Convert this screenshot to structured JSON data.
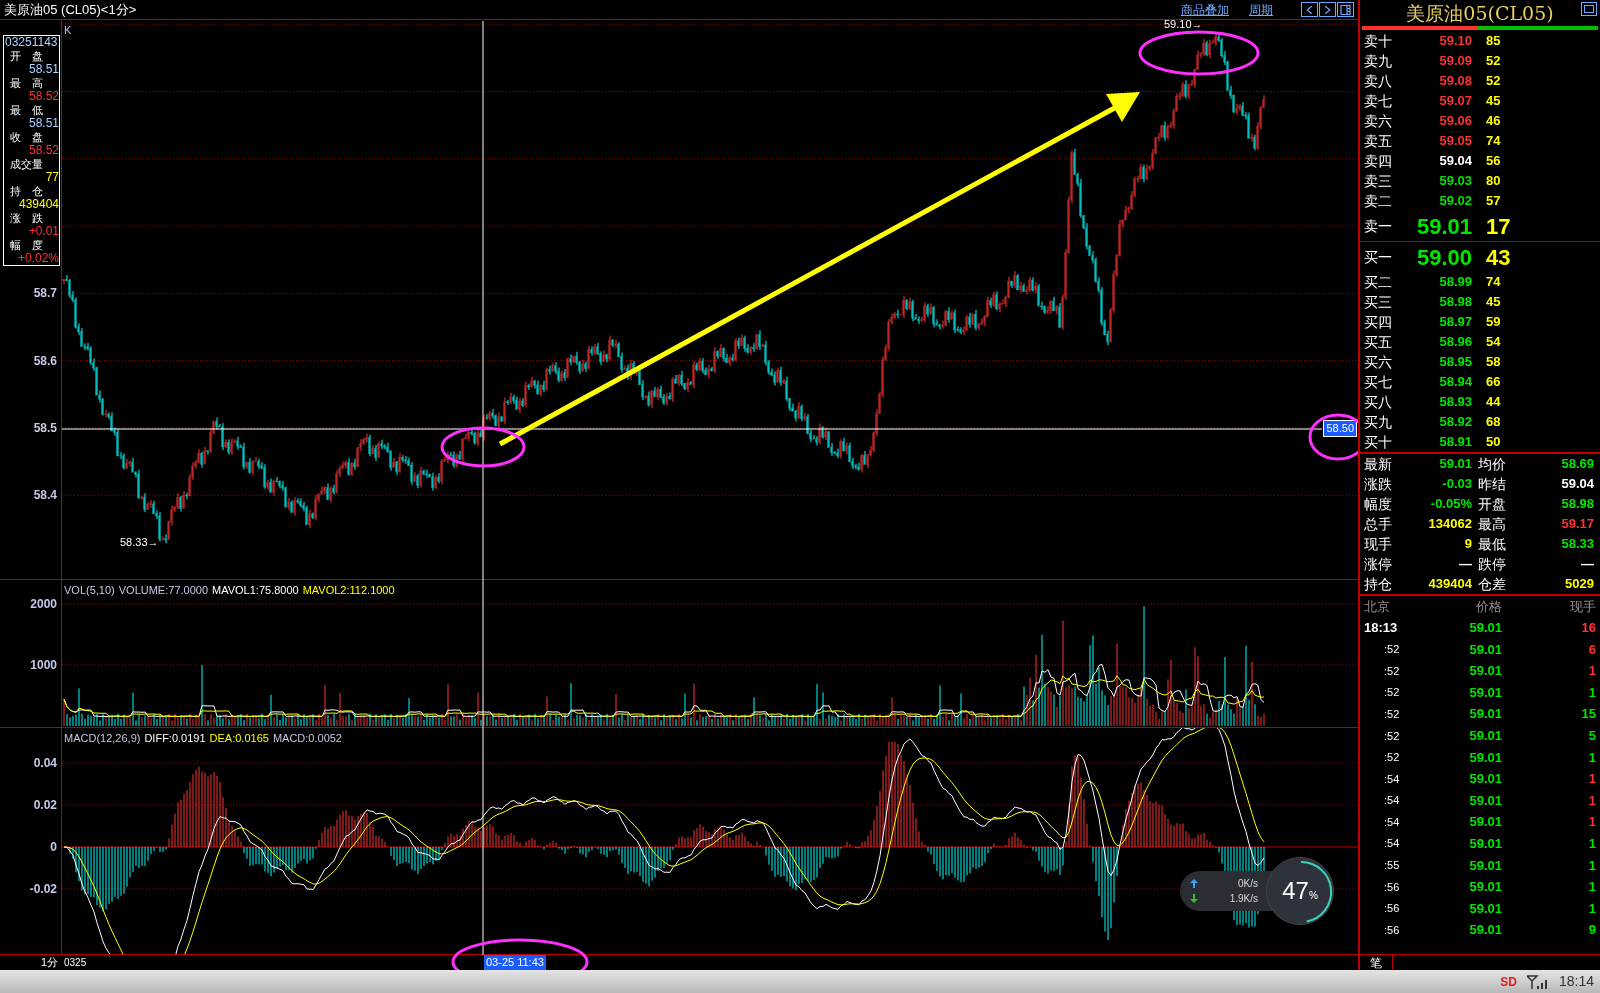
{
  "title_bar": {
    "title": "美原油05 (CL05)<1分>",
    "links": [
      "商品叠加",
      "周期"
    ]
  },
  "info_panel": {
    "time": "03251143",
    "fields": [
      {
        "label": "开　盘",
        "value": "58.51",
        "color": "#a8d4ff"
      },
      {
        "label": "最　高",
        "value": "58.52",
        "color": "#ff3232"
      },
      {
        "label": "最　低",
        "value": "58.51",
        "color": "#a8d4ff"
      },
      {
        "label": "收　盘",
        "value": "58.52",
        "color": "#ff3232"
      },
      {
        "label": "成交量",
        "value": "77",
        "color": "#ffff00"
      },
      {
        "label": "持　仓",
        "value": "439404",
        "color": "#ffff00"
      },
      {
        "label": "涨　跌",
        "value": "+0.01",
        "color": "#ff3232"
      },
      {
        "label": "幅　度",
        "value": "+0.02%",
        "color": "#ff3232"
      }
    ]
  },
  "price_chart": {
    "corner_label": "K",
    "axis_labels": [
      "58.7",
      "58.6",
      "58.5",
      "58.4"
    ],
    "high_marker": "59.10→",
    "low_marker": "58.33→",
    "crosshair_price": "58.50",
    "crosshair_time": "03-25 11:43"
  },
  "volume_chart": {
    "legend": [
      {
        "text": "VOL(5,10)",
        "color": "#c8c8e8"
      },
      {
        "text": "VOLUME:77.0000",
        "color": "#c8c8e8"
      },
      {
        "text": "MAVOL1:75.8000",
        "color": "#ffffff"
      },
      {
        "text": "MAVOL2:112.1000",
        "color": "#ffff00"
      }
    ],
    "axis_labels": [
      "2000",
      "1000"
    ]
  },
  "macd_chart": {
    "legend": [
      {
        "text": "MACD(12,26,9)",
        "color": "#c8c8e8"
      },
      {
        "text": "DIFF:0.0191",
        "color": "#ffffff"
      },
      {
        "text": "DEA:0.0165",
        "color": "#ffff00"
      },
      {
        "text": "MACD:0.0052",
        "color": "#c8c8e8"
      }
    ],
    "axis_labels": [
      "0.04",
      "0.02",
      "0",
      "-0.02"
    ]
  },
  "time_axis": {
    "period": "1分",
    "date": "0325"
  },
  "quote_panel": {
    "title": "美原油05(CL05)",
    "ratio_bar": {
      "level": 0.49
    },
    "asks": [
      {
        "label": "卖十",
        "price": "59.10",
        "volume": "85",
        "color": "#ff3232",
        "kind": "level"
      },
      {
        "label": "卖九",
        "price": "59.09",
        "volume": "52",
        "color": "#ff3232",
        "kind": "level"
      },
      {
        "label": "卖八",
        "price": "59.08",
        "volume": "52",
        "color": "#ff3232",
        "kind": "level"
      },
      {
        "label": "卖七",
        "price": "59.07",
        "volume": "45",
        "color": "#ff3232",
        "kind": "level"
      },
      {
        "label": "卖六",
        "price": "59.06",
        "volume": "46",
        "color": "#ff3232",
        "kind": "level"
      },
      {
        "label": "卖五",
        "price": "59.05",
        "volume": "74",
        "color": "#ff3232",
        "kind": "level"
      },
      {
        "label": "卖四",
        "price": "59.04",
        "volume": "56",
        "color": "#ffffff",
        "kind": "level"
      },
      {
        "label": "卖三",
        "price": "59.03",
        "volume": "80",
        "color": "#00e600",
        "kind": "level"
      },
      {
        "label": "卖二",
        "price": "59.02",
        "volume": "57",
        "color": "#00e600",
        "kind": "level"
      },
      {
        "label": "卖一",
        "price": "59.01",
        "volume": "17",
        "color": "#00e600",
        "kind": "best"
      }
    ],
    "bids": [
      {
        "label": "买一",
        "price": "59.00",
        "volume": "43",
        "color": "#00e600",
        "kind": "best"
      },
      {
        "label": "买二",
        "price": "58.99",
        "volume": "74",
        "color": "#00e600",
        "kind": "level"
      },
      {
        "label": "买三",
        "price": "58.98",
        "volume": "45",
        "color": "#00e600",
        "kind": "level"
      },
      {
        "label": "买四",
        "price": "58.97",
        "volume": "59",
        "color": "#00e600",
        "kind": "level"
      },
      {
        "label": "买五",
        "price": "58.96",
        "volume": "54",
        "color": "#00e600",
        "kind": "level"
      },
      {
        "label": "买六",
        "price": "58.95",
        "volume": "58",
        "color": "#00e600",
        "kind": "level"
      },
      {
        "label": "买七",
        "price": "58.94",
        "volume": "66",
        "color": "#00e600",
        "kind": "level"
      },
      {
        "label": "买八",
        "price": "58.93",
        "volume": "44",
        "color": "#00e600",
        "kind": "level"
      },
      {
        "label": "买九",
        "price": "58.92",
        "volume": "68",
        "color": "#00e600",
        "kind": "level"
      },
      {
        "label": "买十",
        "price": "58.91",
        "volume": "50",
        "color": "#00e600",
        "kind": "level"
      }
    ],
    "stats": [
      [
        {
          "label": "最新",
          "value": "59.01",
          "color": "#00e600"
        },
        {
          "label": "均价",
          "value": "58.69",
          "color": "#00e600"
        }
      ],
      [
        {
          "label": "涨跌",
          "value": "-0.03",
          "color": "#00e600"
        },
        {
          "label": "昨结",
          "value": "59.04",
          "color": "#ffffff"
        }
      ],
      [
        {
          "label": "幅度",
          "value": "-0.05%",
          "color": "#00e600"
        },
        {
          "label": "开盘",
          "value": "58.98",
          "color": "#00e600"
        }
      ],
      [
        {
          "label": "总手",
          "value": "134062",
          "color": "#ffff00"
        },
        {
          "label": "最高",
          "value": "59.17",
          "color": "#ff3232"
        }
      ],
      [
        {
          "label": "现手",
          "value": "9",
          "color": "#ffff00"
        },
        {
          "label": "最低",
          "value": "58.33",
          "color": "#00e600"
        }
      ],
      [
        {
          "label": "涨停",
          "value": "—",
          "color": "#ffffff"
        },
        {
          "label": "跌停",
          "value": "—",
          "color": "#ffffff"
        }
      ],
      [
        {
          "label": "持仓",
          "value": "439404",
          "color": "#ffff00"
        },
        {
          "label": "仓差",
          "value": "5029",
          "color": "#ffff00"
        }
      ]
    ],
    "trades_header": [
      "北京",
      "价格",
      "现手"
    ],
    "trades": [
      {
        "time": "18:13",
        "price": "59.01",
        "volume": "16",
        "color": "#ff3232"
      },
      {
        "time": ":52",
        "price": "59.01",
        "volume": "6",
        "color": "#ff3232"
      },
      {
        "time": ":52",
        "price": "59.01",
        "volume": "1",
        "color": "#ff3232"
      },
      {
        "time": ":52",
        "price": "59.01",
        "volume": "1",
        "color": "#00e600"
      },
      {
        "time": ":52",
        "price": "59.01",
        "volume": "15",
        "color": "#00e600"
      },
      {
        "time": ":52",
        "price": "59.01",
        "volume": "5",
        "color": "#00e600"
      },
      {
        "time": ":52",
        "price": "59.01",
        "volume": "1",
        "color": "#00e600"
      },
      {
        "time": ":54",
        "price": "59.01",
        "volume": "1",
        "color": "#ff3232"
      },
      {
        "time": ":54",
        "price": "59.01",
        "volume": "1",
        "color": "#ff3232"
      },
      {
        "time": ":54",
        "price": "59.01",
        "volume": "1",
        "color": "#ff3232"
      },
      {
        "time": ":54",
        "price": "59.01",
        "volume": "1",
        "color": "#00e600"
      },
      {
        "time": ":55",
        "price": "59.01",
        "volume": "1",
        "color": "#00e600"
      },
      {
        "time": ":56",
        "price": "59.01",
        "volume": "1",
        "color": "#00e600"
      },
      {
        "time": ":56",
        "price": "59.01",
        "volume": "1",
        "color": "#00e600"
      },
      {
        "time": ":56",
        "price": "59.01",
        "volume": "9",
        "color": "#00e600"
      }
    ],
    "tab": "笔"
  },
  "network_widget": {
    "upload": "0K/s",
    "download": "1.9K/s",
    "load_value": "47",
    "load_unit": "%",
    "level": 0.47
  },
  "status_bar": {
    "badge": "SD",
    "clock": "18:14"
  }
}
